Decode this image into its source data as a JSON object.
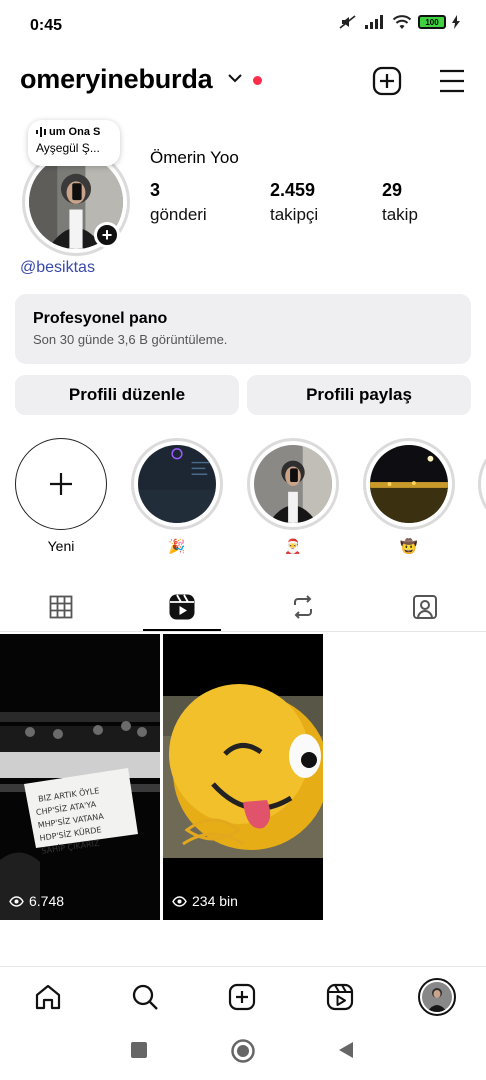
{
  "status_bar": {
    "time": "0:45",
    "battery": "100"
  },
  "header": {
    "username": "omeryineburda",
    "icons": [
      "chevron-down-icon",
      "new-post-icon",
      "menu-icon"
    ],
    "notification_dot_color": "#ff2d4a"
  },
  "note": {
    "song_line": "um Ona S",
    "artist_line": "Ayşegül Ş..."
  },
  "profile": {
    "display_name": "Ömerin Yoo",
    "threads_handle": "@besiktas",
    "stats": [
      {
        "value": "3",
        "label": "gönderi"
      },
      {
        "value": "2.459",
        "label": "takipçi"
      },
      {
        "value": "29",
        "label": "takip"
      }
    ]
  },
  "pro_dashboard": {
    "title": "Profesyonel pano",
    "subtitle": "Son 30 günde 3,6 B görüntüleme."
  },
  "buttons": {
    "edit_profile": "Profili düzenle",
    "share_profile": "Profili paylaş"
  },
  "highlights": [
    {
      "label": "Yeni"
    },
    {
      "label": "🎉"
    },
    {
      "label": "🎅"
    },
    {
      "label": "🤠"
    }
  ],
  "tabs": [
    "grid-icon",
    "reels-icon",
    "reposts-icon",
    "tagged-icon"
  ],
  "reels": [
    {
      "views": "6.748"
    },
    {
      "views": "234 bin"
    }
  ],
  "colors": {
    "link": "#3949ab",
    "card_bg": "#efeff2"
  }
}
